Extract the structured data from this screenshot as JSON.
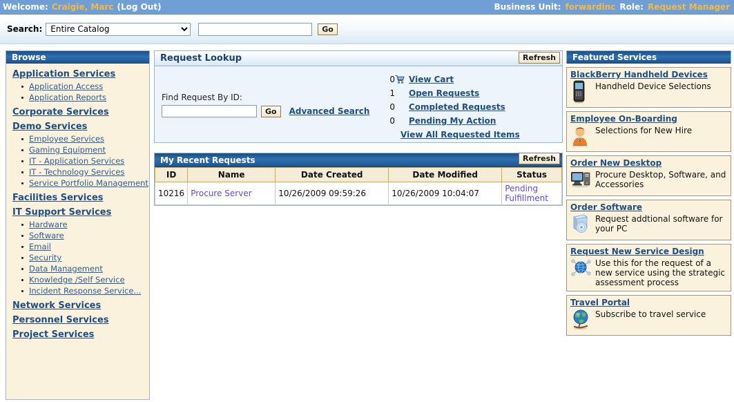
{
  "topbar": {
    "welcome_label": "Welcome:",
    "user_name": "Craigie, Marc",
    "logout_label": "(Log Out)",
    "business_unit_label": "Business Unit:",
    "business_unit_value": "forwardinc",
    "role_label": "Role:",
    "role_value": "Request Manager",
    "bg_color": "#6f9fd4",
    "highlight_color": "#f5b942"
  },
  "search": {
    "label": "Search:",
    "selected_scope": "Entire Catalog",
    "scope_options": [
      "Entire Catalog"
    ],
    "query_value": "",
    "query_placeholder": "",
    "go_label": "Go"
  },
  "browse": {
    "title": "Browse",
    "categories": [
      {
        "label": "Application Services",
        "items": [
          "Application Access",
          "Application Reports"
        ]
      },
      {
        "label": "Corporate Services",
        "items": []
      },
      {
        "label": "Demo Services",
        "items": [
          "Employee Services",
          "Gaming Equipment",
          "IT - Application Services",
          "IT - Technology Services",
          "Service Portfolio Management"
        ]
      },
      {
        "label": "Facilities Services",
        "items": []
      },
      {
        "label": "IT Support Services",
        "items": [
          "Hardware",
          "Software",
          "Email",
          "Security",
          "Data Management",
          "Knowledge /Self Service",
          "Incident Response Service..."
        ]
      },
      {
        "label": "Network Services",
        "items": []
      },
      {
        "label": "Personnel Services",
        "items": []
      },
      {
        "label": "Project Services",
        "items": []
      }
    ]
  },
  "request_lookup": {
    "title": "Request Lookup",
    "refresh_label": "Refresh",
    "find_by_id_label": "Find Request By ID:",
    "find_by_id_value": "",
    "go_label": "Go",
    "advanced_search_label": "Advanced Search",
    "stats": [
      {
        "count": "0",
        "label": "View Cart",
        "icon": "shopping-cart-icon"
      },
      {
        "count": "1",
        "label": "Open Requests",
        "icon": ""
      },
      {
        "count": "0",
        "label": "Completed Requests",
        "icon": ""
      },
      {
        "count": "0",
        "label": "Pending My Action",
        "icon": ""
      }
    ],
    "view_all_label": "View All Requested Items"
  },
  "recent_requests": {
    "title": "My Recent Requests",
    "refresh_label": "Refresh",
    "columns": [
      "ID",
      "Name",
      "Date Created",
      "Date Modified",
      "Status"
    ],
    "rows": [
      {
        "id": "10216",
        "name": "Procure Server",
        "date_created": "10/26/2009 09:59:26",
        "date_modified": "10/26/2009 10:04:07",
        "status": "Pending Fulfillment"
      }
    ]
  },
  "featured_services": {
    "title": "Featured Services",
    "cards": [
      {
        "title": "BlackBerry Handheld Devices",
        "desc": "Handheld Device Selections",
        "icon": "blackberry-device-icon"
      },
      {
        "title": "Employee On-Boarding",
        "desc": "Selections for New Hire",
        "icon": "person-icon"
      },
      {
        "title": "Order New Desktop",
        "desc": "Procure Desktop, Software, and Accessories",
        "icon": "desktop-computer-icon"
      },
      {
        "title": "Order Software",
        "desc": "Request addtional software for your PC",
        "icon": "cd-stack-icon"
      },
      {
        "title": "Request New Service Design",
        "desc": "Use this for the request of a new service using the strategic assessment process",
        "icon": "network-globe-icon"
      },
      {
        "title": "Travel Portal",
        "desc": "Subscribe to travel service",
        "icon": "globe-stand-icon"
      }
    ]
  }
}
